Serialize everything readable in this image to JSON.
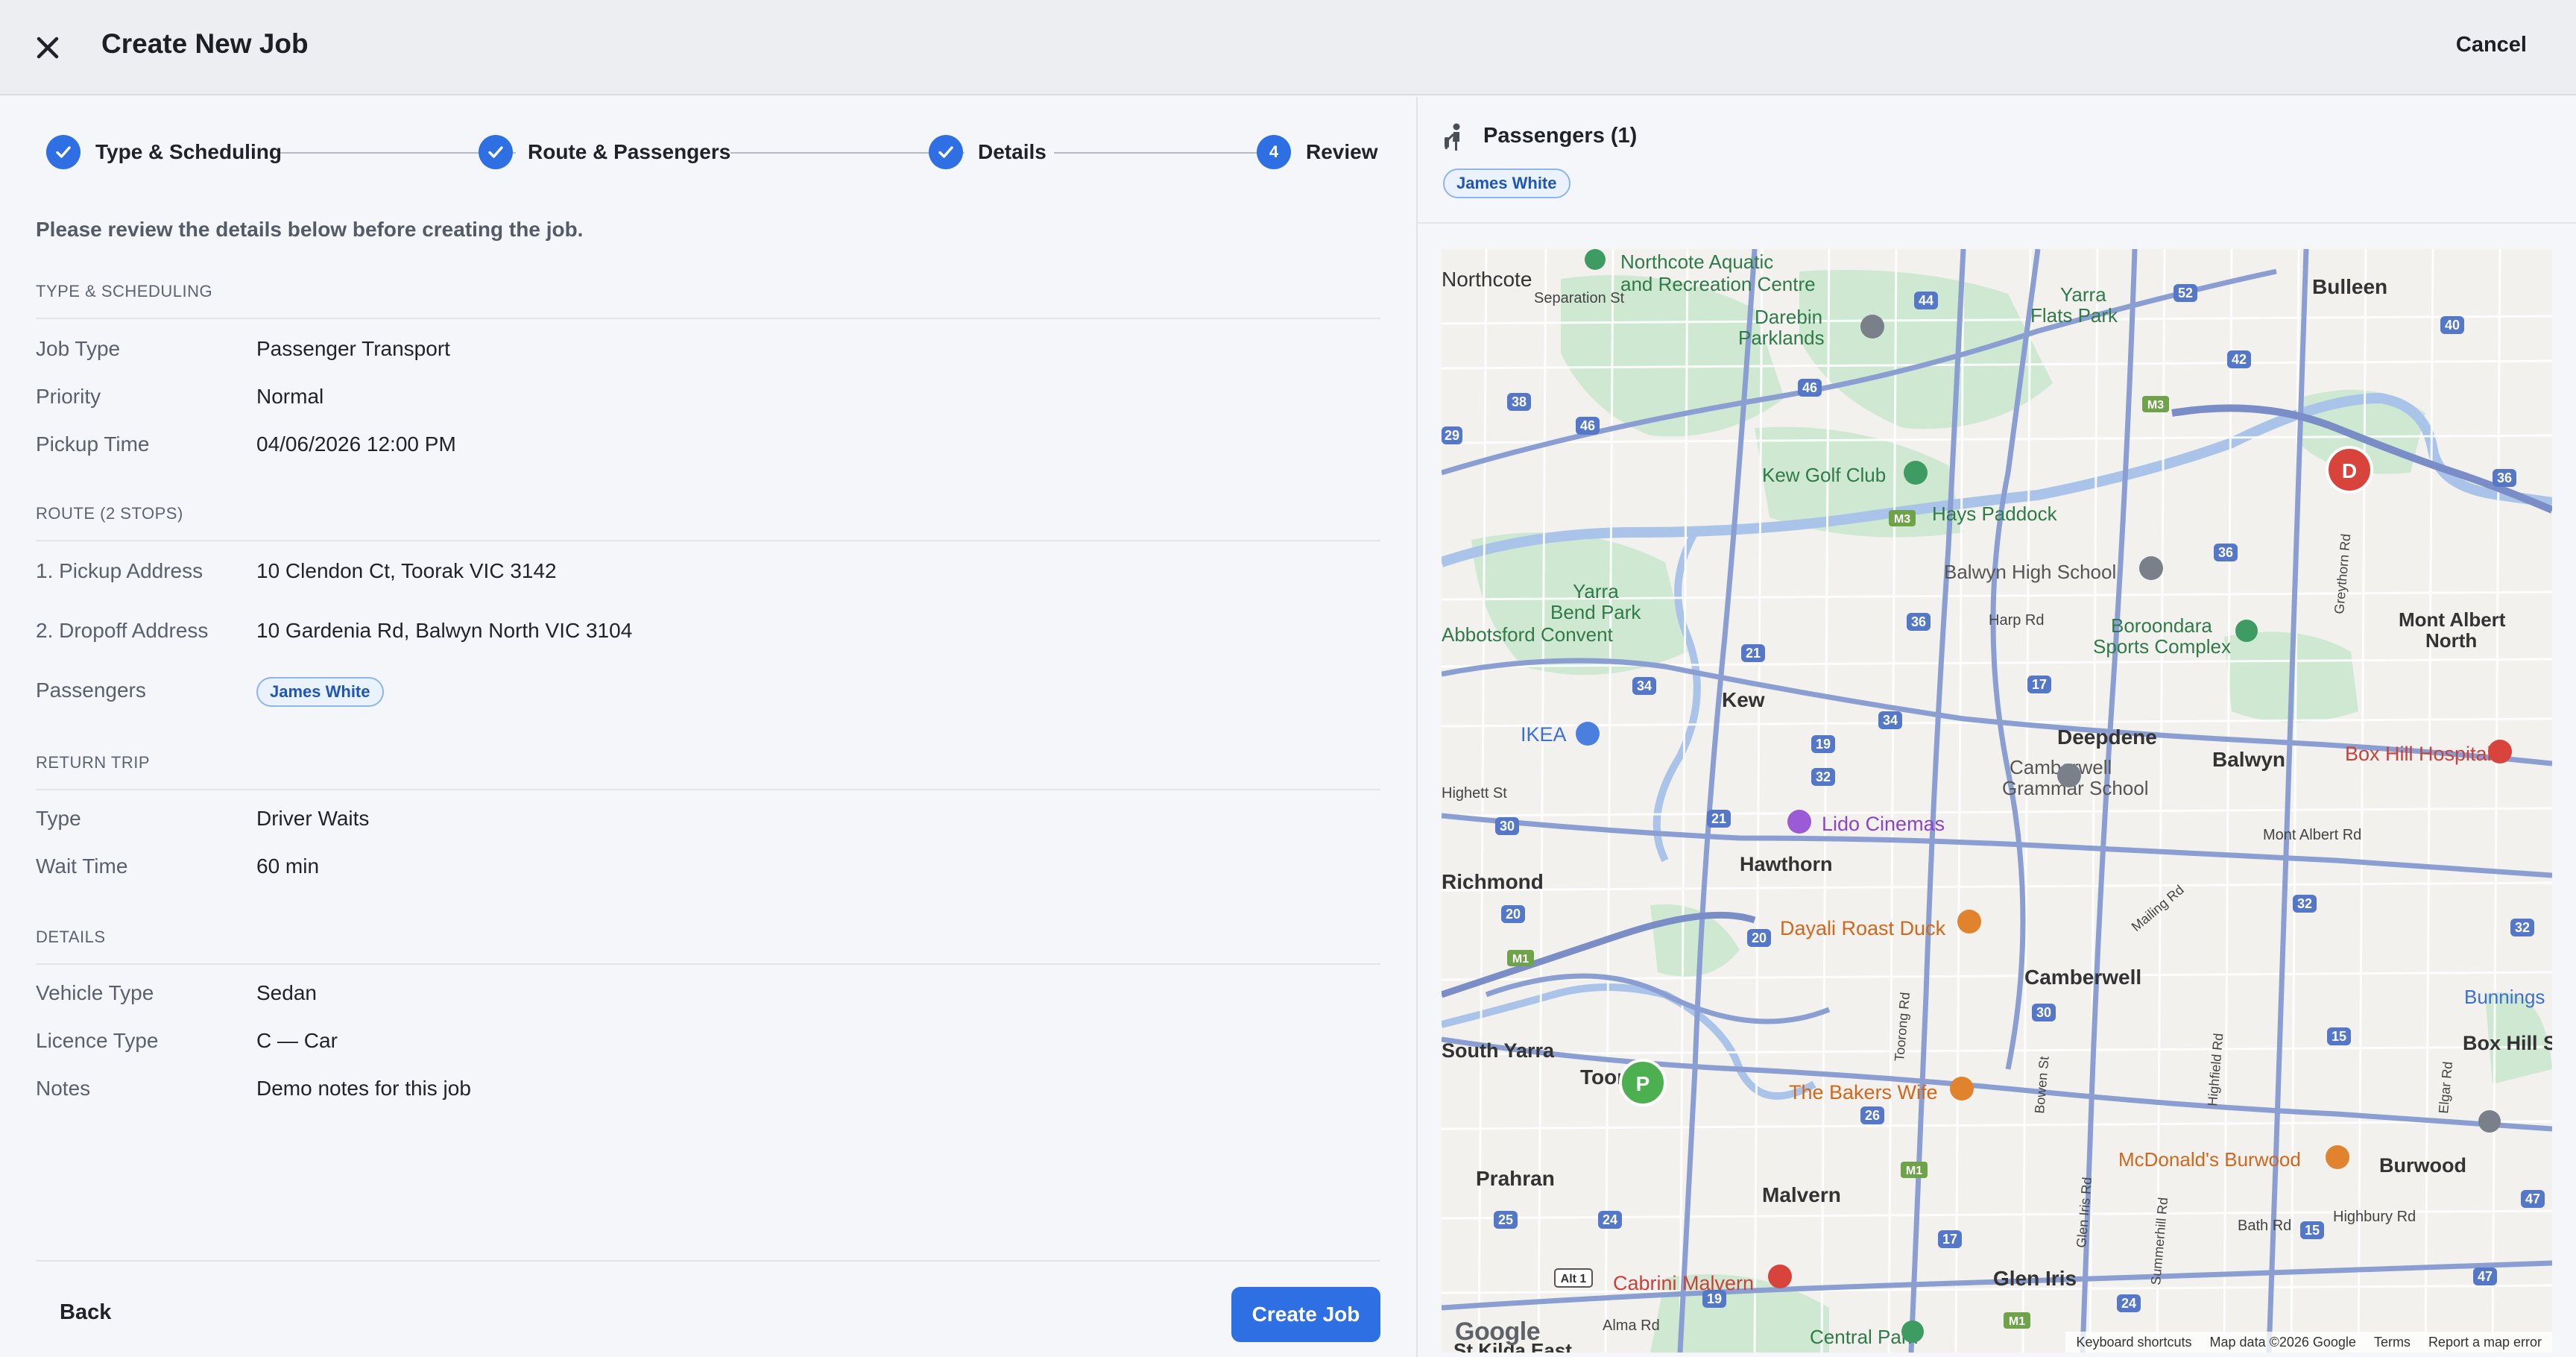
{
  "header": {
    "title": "Create New Job",
    "cancel_label": "Cancel"
  },
  "stepper": {
    "steps": [
      {
        "label": "Type & Scheduling",
        "state": "complete"
      },
      {
        "label": "Route & Passengers",
        "state": "complete"
      },
      {
        "label": "Details",
        "state": "complete"
      },
      {
        "label": "Review",
        "state": "active",
        "number": "4"
      }
    ]
  },
  "intro": "Please review the details below before creating the job.",
  "sections": {
    "type_scheduling": {
      "heading": "Type & Scheduling",
      "rows": [
        {
          "label": "Job Type",
          "value": "Passenger Transport"
        },
        {
          "label": "Priority",
          "value": "Normal"
        },
        {
          "label": "Pickup Time",
          "value": "04/06/2026 12:00 PM"
        }
      ]
    },
    "route": {
      "heading": "Route (2 stops)",
      "rows": [
        {
          "label": "1. Pickup Address",
          "value": "10 Clendon Ct, Toorak VIC 3142"
        },
        {
          "label": "2. Dropoff Address",
          "value": "10 Gardenia Rd, Balwyn North VIC 3104"
        }
      ],
      "passengers_label": "Passengers",
      "passengers": [
        "James White"
      ]
    },
    "return_trip": {
      "heading": "Return Trip",
      "rows": [
        {
          "label": "Type",
          "value": "Driver Waits"
        },
        {
          "label": "Wait Time",
          "value": "60 min"
        }
      ]
    },
    "details": {
      "heading": "Details",
      "rows": [
        {
          "label": "Vehicle Type",
          "value": "Sedan"
        },
        {
          "label": "Licence Type",
          "value": "C — Car"
        },
        {
          "label": "Notes",
          "value": "Demo notes for this job"
        }
      ]
    }
  },
  "footer": {
    "back_label": "Back",
    "create_label": "Create Job"
  },
  "passengers_panel": {
    "title": "Passengers (1)",
    "chip": "James White"
  },
  "map": {
    "pickup_marker": "P",
    "dropoff_marker": "D",
    "logo": "Google",
    "attribution": [
      "Keyboard shortcuts",
      "Map data ©2026 Google",
      "Terms",
      "Report a map error"
    ],
    "places": [
      {
        "name": "Northcote Aquatic",
        "kind": "green"
      },
      {
        "name": "and Recreation Centre",
        "kind": "green"
      },
      {
        "name": "Northcote",
        "kind": "suburb"
      },
      {
        "name": "Separation St",
        "kind": "street"
      },
      {
        "name": "Darebin",
        "kind": "green"
      },
      {
        "name": "Parklands",
        "kind": "green"
      },
      {
        "name": "Yarra",
        "kind": "green"
      },
      {
        "name": "Flats Park",
        "kind": "green"
      },
      {
        "name": "Bulleen",
        "kind": "suburb"
      },
      {
        "name": "Kew Golf Club",
        "kind": "green"
      },
      {
        "name": "Hays Paddock",
        "kind": "green"
      },
      {
        "name": "Yarra",
        "kind": "green"
      },
      {
        "name": "Bend Park",
        "kind": "green"
      },
      {
        "name": "Abbotsford Convent",
        "kind": "green"
      },
      {
        "name": "Balwyn High School",
        "kind": "poi"
      },
      {
        "name": "Harp Rd",
        "kind": "street"
      },
      {
        "name": "Boroondara",
        "kind": "green"
      },
      {
        "name": "Sports Complex",
        "kind": "green"
      },
      {
        "name": "Mont Albert",
        "kind": "suburb"
      },
      {
        "name": "North",
        "kind": "suburb"
      },
      {
        "name": "Greythorn Rd",
        "kind": "street"
      },
      {
        "name": "Kew",
        "kind": "suburb"
      },
      {
        "name": "Deepdene",
        "kind": "suburb"
      },
      {
        "name": "Balwyn",
        "kind": "suburb"
      },
      {
        "name": "Box Hill Hospital",
        "kind": "hospital"
      },
      {
        "name": "IKEA",
        "kind": "shop"
      },
      {
        "name": "Camberwell",
        "kind": "poi"
      },
      {
        "name": "Grammar School",
        "kind": "poi"
      },
      {
        "name": "Lido Cinemas",
        "kind": "cinema"
      },
      {
        "name": "Highett St",
        "kind": "street"
      },
      {
        "name": "Hawthorn",
        "kind": "suburb"
      },
      {
        "name": "Richmond",
        "kind": "suburb"
      },
      {
        "name": "Mont Albert Rd",
        "kind": "street"
      },
      {
        "name": "Dayali Roast Duck",
        "kind": "food"
      },
      {
        "name": "Mailing Rd",
        "kind": "street"
      },
      {
        "name": "Camberwell",
        "kind": "suburb"
      },
      {
        "name": "Bunnings",
        "kind": "shop"
      },
      {
        "name": "Toorak",
        "kind": "suburb"
      },
      {
        "name": "Toorong Rd",
        "kind": "street"
      },
      {
        "name": "South Yarra",
        "kind": "suburb"
      },
      {
        "name": "The Bakers Wife",
        "kind": "food"
      },
      {
        "name": "Bowen St",
        "kind": "street"
      },
      {
        "name": "Highfield Rd",
        "kind": "street"
      },
      {
        "name": "Box Hill S",
        "kind": "suburb"
      },
      {
        "name": "Elgar Rd",
        "kind": "street"
      },
      {
        "name": "Prahran",
        "kind": "suburb"
      },
      {
        "name": "McDonald's Burwood",
        "kind": "food"
      },
      {
        "name": "Burwood",
        "kind": "suburb"
      },
      {
        "name": "Malvern",
        "kind": "suburb"
      },
      {
        "name": "Glen Iris Rd",
        "kind": "street"
      },
      {
        "name": "Summerhill Rd",
        "kind": "street"
      },
      {
        "name": "Bath Rd",
        "kind": "street"
      },
      {
        "name": "Highbury Rd",
        "kind": "street"
      },
      {
        "name": "Cabrini Malvern",
        "kind": "hospital"
      },
      {
        "name": "Glen Iris",
        "kind": "suburb"
      },
      {
        "name": "Alma Rd",
        "kind": "street"
      },
      {
        "name": "Central Park",
        "kind": "green"
      },
      {
        "name": "St Kilda East",
        "kind": "suburb"
      }
    ],
    "route_shields": [
      "44",
      "52",
      "38",
      "46",
      "46",
      "42",
      "40",
      "29",
      "M3",
      "36",
      "M3",
      "21",
      "36",
      "36",
      "34",
      "17",
      "19",
      "32",
      "21",
      "34",
      "30",
      "20",
      "M1",
      "32",
      "15",
      "32",
      "20",
      "30",
      "26",
      "M1",
      "25",
      "24",
      "17",
      "19",
      "24",
      "47",
      "15",
      "47",
      "Alt 1",
      "M1"
    ]
  }
}
